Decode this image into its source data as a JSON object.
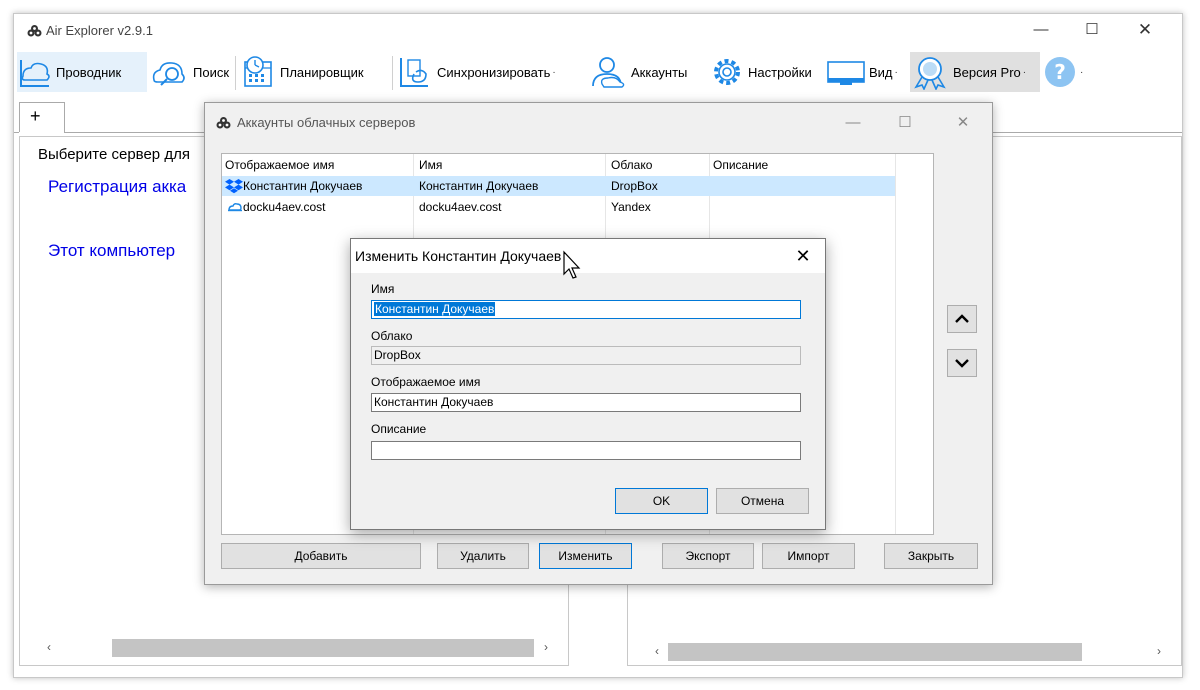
{
  "window": {
    "title": "Air Explorer v2.9.1",
    "min_glyph": "—",
    "max_glyph": "☐",
    "close_glyph": "✕"
  },
  "toolbar": {
    "explorer": "Проводник",
    "search": "Поиск",
    "scheduler": "Планировщик",
    "sync": "Синхронизировать",
    "accounts": "Аккаунты",
    "settings": "Настройки",
    "view": "Вид",
    "pro": "Версия Pro",
    "dropdown_glyph": "·"
  },
  "tabs": {
    "add_label": "+"
  },
  "left_panel": {
    "prompt": "Выберите сервер для",
    "register_link": "Регистрация акка",
    "this_computer_link": "Этот компьютер"
  },
  "scroll": {
    "left": "‹",
    "right": "›"
  },
  "accounts_dialog": {
    "title": "Аккаунты облачных серверов",
    "columns": [
      "Отображаемое имя",
      "Имя",
      "Облако",
      "Описание"
    ],
    "rows": [
      {
        "display_name": "Константин Докучаев",
        "name": "Константин Докучаев",
        "cloud": "DropBox",
        "description": "",
        "icon": "dropbox-icon"
      },
      {
        "display_name": "docku4aev.cost",
        "name": "docku4aev.cost",
        "cloud": "Yandex",
        "description": "",
        "icon": "yandex-icon"
      }
    ],
    "buttons": {
      "add": "Добавить",
      "delete": "Удалить",
      "edit": "Изменить",
      "export": "Экспорт",
      "import": "Импорт",
      "close": "Закрыть"
    }
  },
  "edit_dialog": {
    "title": "Изменить Константин Докучаев",
    "close_glyph": "✕",
    "name_label": "Имя",
    "name_value": "Константин Докучаев",
    "cloud_label": "Облако",
    "cloud_value": "DropBox",
    "display_label": "Отображаемое имя",
    "display_value": "Константин Докучаев",
    "description_label": "Описание",
    "description_value": "",
    "ok": "OK",
    "cancel": "Отмена"
  },
  "colors": {
    "selection": "#cce8ff",
    "link": "#0000e6",
    "focus": "#0078d7",
    "dropbox": "#0061fe",
    "icon_blue": "#1e88e5"
  }
}
